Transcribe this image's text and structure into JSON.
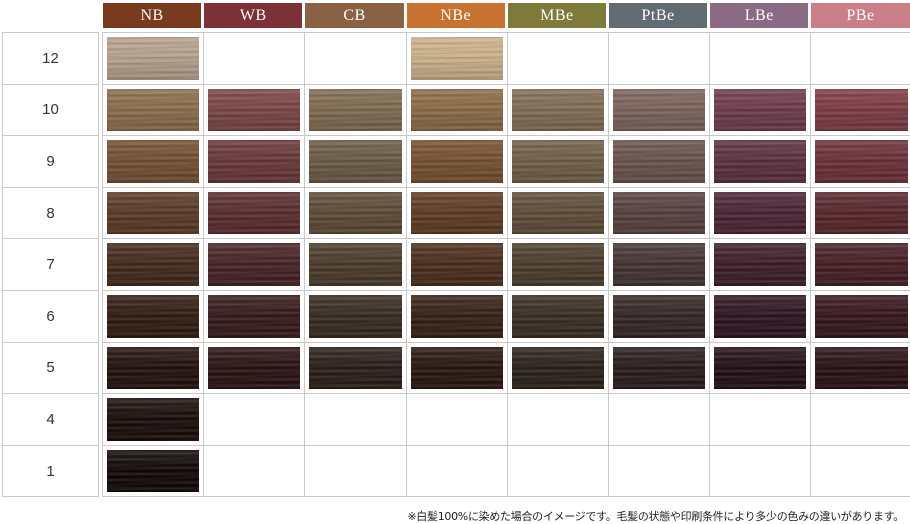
{
  "chart_data": {
    "type": "table",
    "columns": [
      {
        "label": "NB",
        "color": "#7a3a1e"
      },
      {
        "label": "WB",
        "color": "#7b3135"
      },
      {
        "label": "CB",
        "color": "#8a6142"
      },
      {
        "label": "NBe",
        "color": "#c87231"
      },
      {
        "label": "MBe",
        "color": "#7d7a3a"
      },
      {
        "label": "PtBe",
        "color": "#606b72"
      },
      {
        "label": "LBe",
        "color": "#8b6b83"
      },
      {
        "label": "PBe",
        "color": "#c97f85"
      }
    ],
    "rows": [
      {
        "level": "12",
        "swatches": [
          "#b5a08c",
          null,
          null,
          "#cbb08a",
          null,
          null,
          null,
          null
        ]
      },
      {
        "level": "10",
        "swatches": [
          "#8b6b4b",
          "#7a4444",
          "#7e6a4f",
          "#8a6a45",
          "#806c52",
          "#7a625a",
          "#6d3a4b",
          "#7c3a42"
        ]
      },
      {
        "level": "9",
        "swatches": [
          "#734f32",
          "#693638",
          "#6a5a44",
          "#754f2f",
          "#6f5e45",
          "#68524a",
          "#5b2f3f",
          "#6a3036"
        ]
      },
      {
        "level": "8",
        "swatches": [
          "#5a3a24",
          "#5a2c2d",
          "#5d4a35",
          "#5e3b22",
          "#5e4c38",
          "#56413e",
          "#4b2434",
          "#57262b"
        ]
      },
      {
        "level": "7",
        "swatches": [
          "#43291a",
          "#472224",
          "#4b3a2b",
          "#4a2d1b",
          "#4b3c2d",
          "#443332",
          "#3c1d29",
          "#461e23"
        ]
      },
      {
        "level": "6",
        "swatches": [
          "#301c12",
          "#36191a",
          "#372a20",
          "#362014",
          "#392d22",
          "#342625",
          "#2d1520",
          "#35161b"
        ]
      },
      {
        "level": "5",
        "swatches": [
          "#22110c",
          "#2a1213",
          "#2a1e17",
          "#28160e",
          "#2a2119",
          "#281c1b",
          "#220f17",
          "#291014"
        ]
      },
      {
        "level": "4",
        "swatches": [
          "#1a0c0a",
          null,
          null,
          null,
          null,
          null,
          null,
          null
        ]
      },
      {
        "level": "1",
        "swatches": [
          "#100807",
          null,
          null,
          null,
          null,
          null,
          null,
          null
        ]
      }
    ],
    "footnote": "※白髪100%に染めた場合のイメージです。毛髪の状態や印刷条件により多少の色みの違いがあります。"
  }
}
